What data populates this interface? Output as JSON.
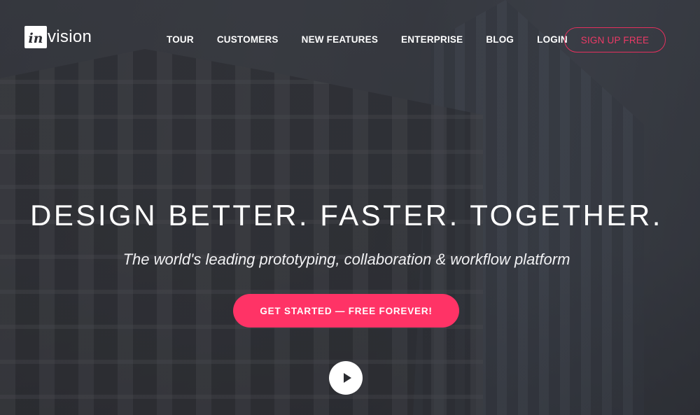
{
  "brand": {
    "logo_mark": "in",
    "logo_word": "vision"
  },
  "nav": {
    "items": [
      {
        "label": "TOUR"
      },
      {
        "label": "CUSTOMERS"
      },
      {
        "label": "NEW FEATURES"
      },
      {
        "label": "ENTERPRISE"
      },
      {
        "label": "BLOG"
      },
      {
        "label": "LOGIN"
      }
    ],
    "signup_label": "SIGN UP FREE"
  },
  "hero": {
    "headline": "DESIGN BETTER. FASTER. TOGETHER.",
    "subheadline": "The world's leading prototyping, collaboration & workflow platform",
    "cta_label": "GET STARTED — FREE FOREVER!",
    "video_icon": "play-icon"
  },
  "colors": {
    "accent": "#ff3366",
    "signup_border": "#e5305e",
    "text": "#ffffff"
  }
}
